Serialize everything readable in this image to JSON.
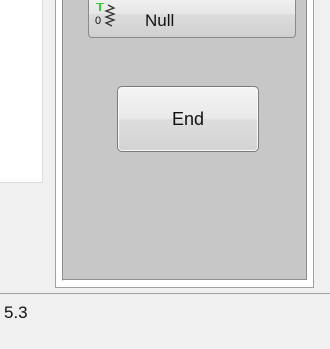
{
  "mode_button": {
    "label": "Null",
    "icon": "spring-icon",
    "icon_digit": "0"
  },
  "end_button": {
    "label": "End"
  },
  "status_bar": {
    "text": "5.3"
  },
  "colors": {
    "panel_gray": "#c7c7c7",
    "window_bg": "#f0f0f0",
    "icon_green": "#33cc33"
  }
}
